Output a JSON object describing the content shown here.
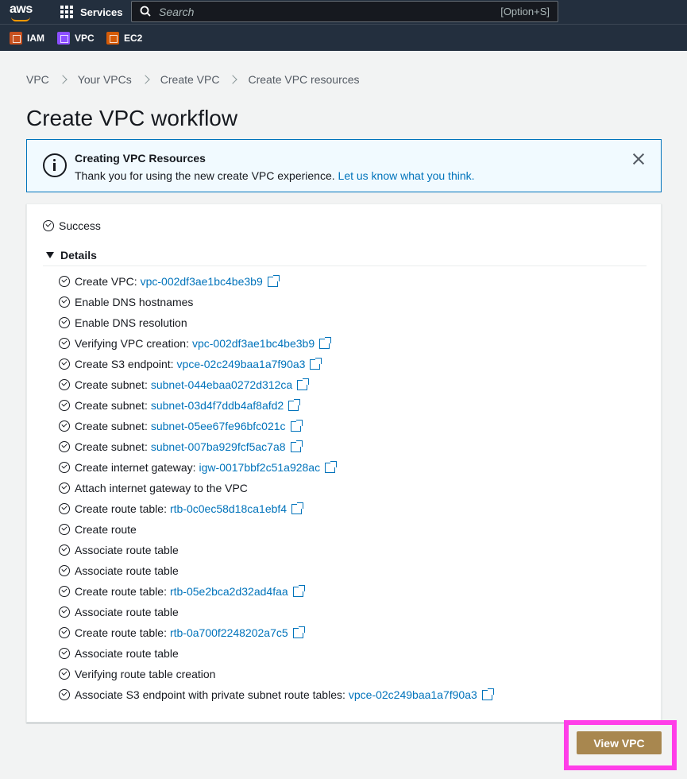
{
  "topnav": {
    "logo": "aws",
    "services_label": "Services",
    "search_placeholder": "Search",
    "search_shortcut": "[Option+S]"
  },
  "favorites": [
    {
      "label": "IAM",
      "icon": "iam-icon"
    },
    {
      "label": "VPC",
      "icon": "vpc-icon"
    },
    {
      "label": "EC2",
      "icon": "ec2-icon"
    }
  ],
  "breadcrumb": [
    "VPC",
    "Your VPCs",
    "Create VPC",
    "Create VPC resources"
  ],
  "page_title": "Create VPC workflow",
  "alert": {
    "title": "Creating VPC Resources",
    "body": "Thank you for using the new create VPC experience.",
    "link": "Let us know what you think."
  },
  "status": "Success",
  "details_label": "Details",
  "steps": [
    {
      "label": "Create VPC:",
      "link": "vpc-002df3ae1bc4be3b9"
    },
    {
      "label": "Enable DNS hostnames",
      "link": null
    },
    {
      "label": "Enable DNS resolution",
      "link": null
    },
    {
      "label": "Verifying VPC creation:",
      "link": "vpc-002df3ae1bc4be3b9"
    },
    {
      "label": "Create S3 endpoint:",
      "link": "vpce-02c249baa1a7f90a3"
    },
    {
      "label": "Create subnet:",
      "link": "subnet-044ebaa0272d312ca"
    },
    {
      "label": "Create subnet:",
      "link": "subnet-03d4f7ddb4af8afd2"
    },
    {
      "label": "Create subnet:",
      "link": "subnet-05ee67fe96bfc021c"
    },
    {
      "label": "Create subnet:",
      "link": "subnet-007ba929fcf5ac7a8"
    },
    {
      "label": "Create internet gateway:",
      "link": "igw-0017bbf2c51a928ac"
    },
    {
      "label": "Attach internet gateway to the VPC",
      "link": null
    },
    {
      "label": "Create route table:",
      "link": "rtb-0c0ec58d18ca1ebf4"
    },
    {
      "label": "Create route",
      "link": null
    },
    {
      "label": "Associate route table",
      "link": null
    },
    {
      "label": "Associate route table",
      "link": null
    },
    {
      "label": "Create route table:",
      "link": "rtb-05e2bca2d32ad4faa"
    },
    {
      "label": "Associate route table",
      "link": null
    },
    {
      "label": "Create route table:",
      "link": "rtb-0a700f2248202a7c5"
    },
    {
      "label": "Associate route table",
      "link": null
    },
    {
      "label": "Verifying route table creation",
      "link": null
    },
    {
      "label": "Associate S3 endpoint with private subnet route tables:",
      "link": "vpce-02c249baa1a7f90a3"
    }
  ],
  "view_button_label": "View VPC",
  "colors": {
    "nav_bg": "#232f3e",
    "link": "#0073bb",
    "button": "#a8874f",
    "highlight": "#ff3ee8"
  }
}
